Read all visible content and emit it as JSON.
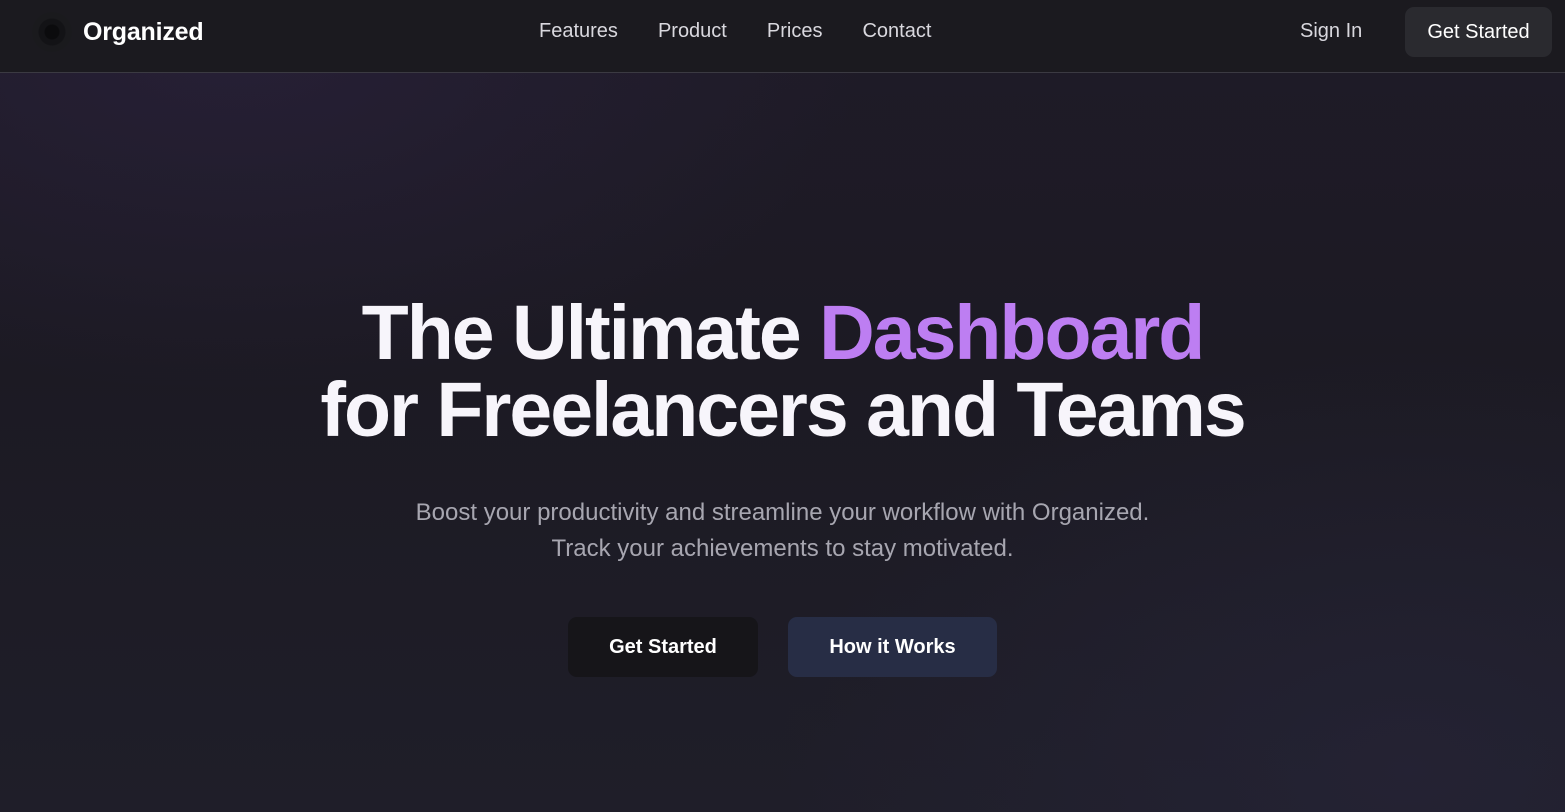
{
  "brand": {
    "name": "Organized"
  },
  "nav": {
    "links": [
      "Features",
      "Product",
      "Prices",
      "Contact"
    ],
    "sign_in": "Sign In",
    "cta": "Get Started"
  },
  "hero": {
    "title_part1": "The Ultimate ",
    "title_accent": "Dashboard",
    "title_line2": "for Freelancers and Teams",
    "subtitle_line1": "Boost your productivity and streamline your workflow with Organized.",
    "subtitle_line2": "Track your achievements to stay motivated.",
    "primary_button": "Get Started",
    "secondary_button": "How it Works"
  },
  "colors": {
    "accent": "#bd7ef2",
    "background": "#1c1a23",
    "secondary_button": "#272d45"
  }
}
